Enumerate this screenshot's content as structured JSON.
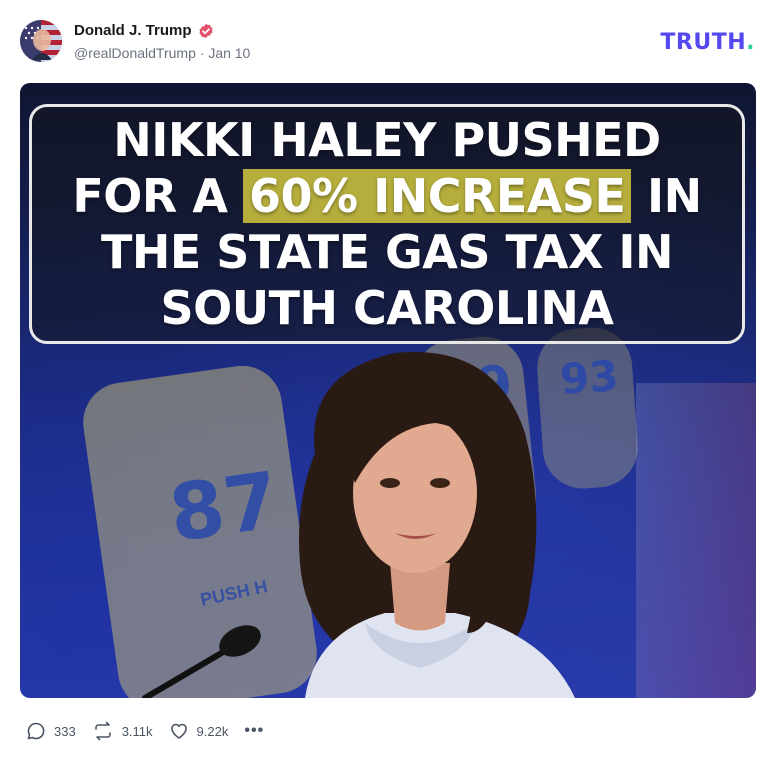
{
  "post": {
    "author_name": "Donald J. Trump",
    "handle": "@realDonaldTrump",
    "separator": "·",
    "date": "Jan 10",
    "verified": true
  },
  "brand": {
    "logo_text": "TRUTH",
    "logo_dot": ".",
    "logo_color": "#5448ee",
    "dot_color": "#2fd39a"
  },
  "media": {
    "headline_lines": [
      "NIKKI HALEY PUSHED",
      "FOR A",
      "60% INCREASE",
      "IN",
      "THE STATE GAS TAX IN",
      "SOUTH CAROLINA"
    ],
    "highlight_color": "#b5ad3c",
    "pump_numbers": [
      "87",
      "89",
      "93"
    ],
    "pump_label": "PUSH H"
  },
  "actions": {
    "replies": "333",
    "retruths": "3.11k",
    "likes": "9.22k",
    "more": "•••"
  },
  "icons": {
    "reply": "reply-icon",
    "retruth": "retruth-icon",
    "like": "heart-icon",
    "more": "more-icon",
    "verified": "verified-badge-icon"
  }
}
